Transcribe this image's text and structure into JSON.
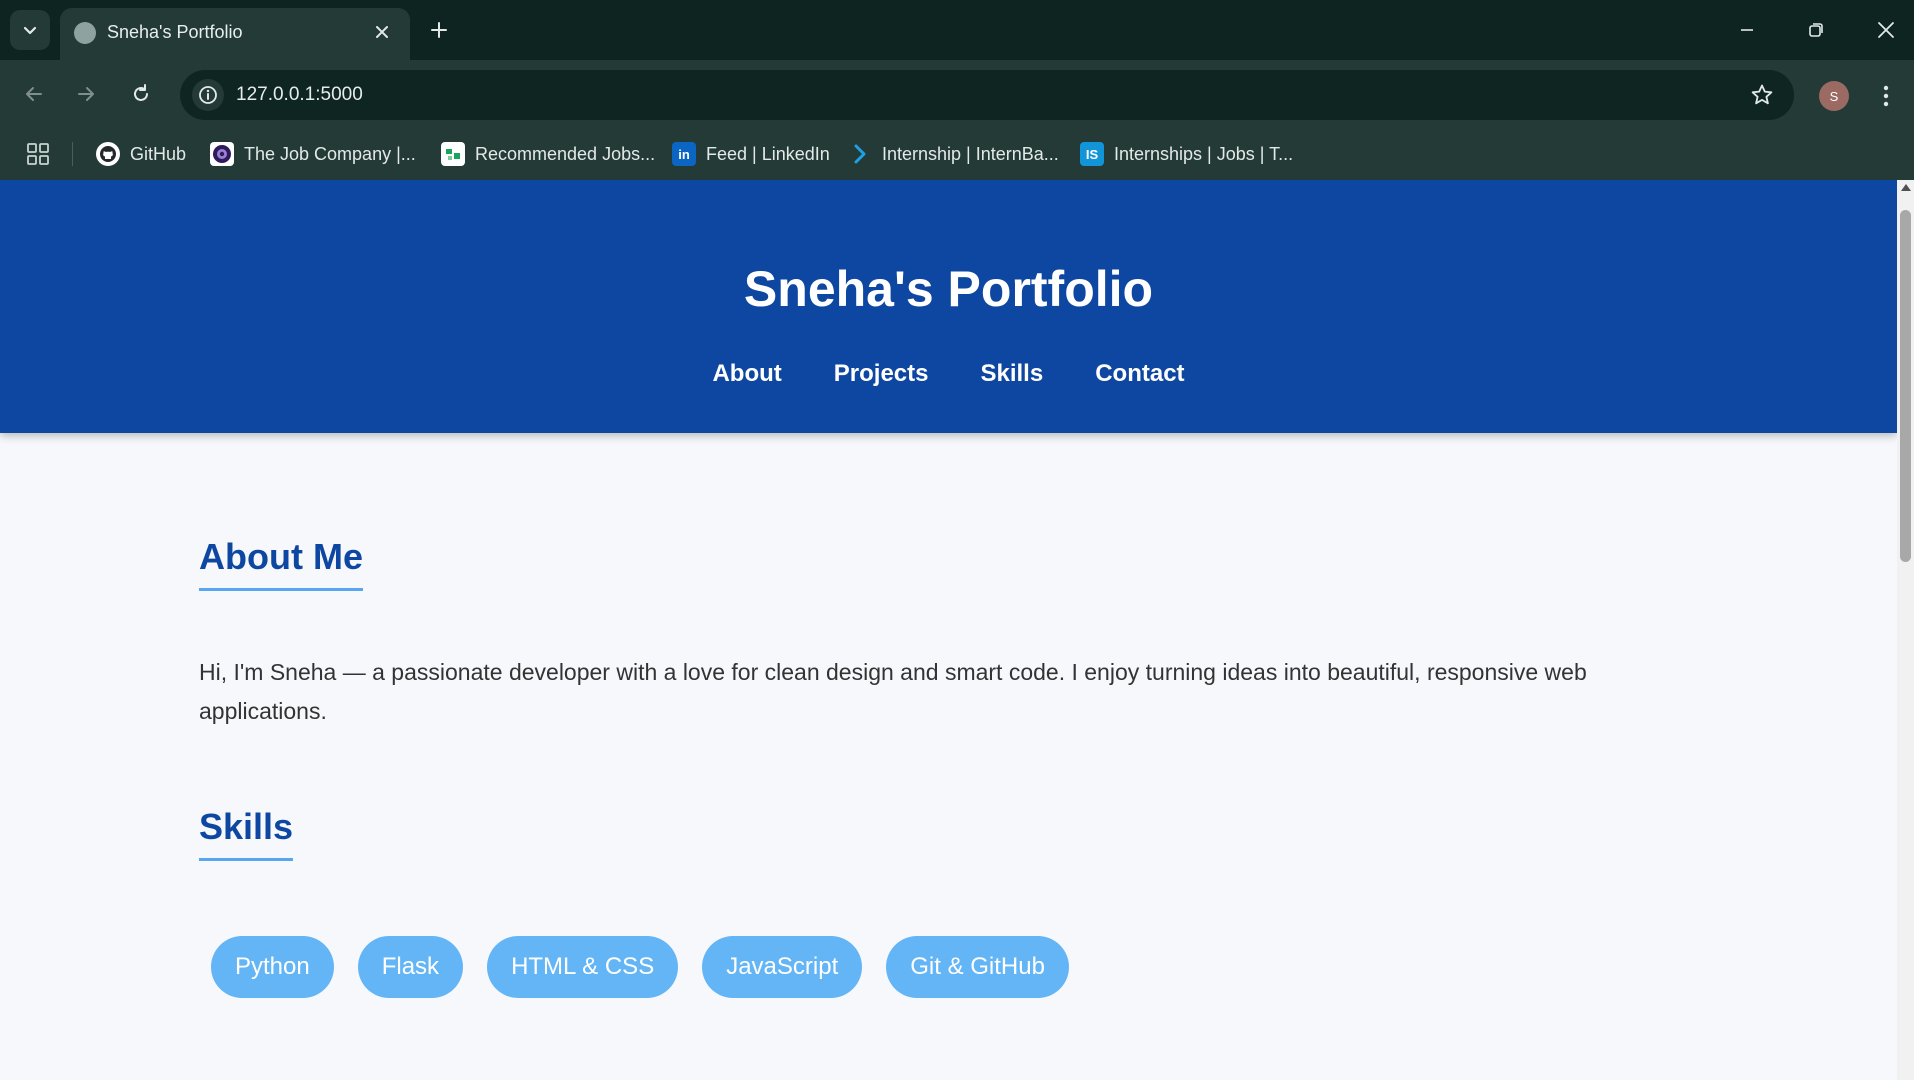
{
  "browser": {
    "tab_title": "Sneha's Portfolio",
    "url": "127.0.0.1:5000",
    "profile_initial": "S",
    "bookmarks": [
      {
        "label": "GitHub",
        "icon": "github-icon"
      },
      {
        "label": "The Job Company |...",
        "icon": "job-company-icon"
      },
      {
        "label": "Recommended Jobs...",
        "icon": "recommended-jobs-icon"
      },
      {
        "label": "Feed | LinkedIn",
        "icon": "linkedin-icon",
        "icon_text": "in"
      },
      {
        "label": "Internship | InternBa...",
        "icon": "internbazaar-icon"
      },
      {
        "label": "Internships | Jobs | T...",
        "icon": "internshala-icon",
        "icon_text": "IS"
      }
    ]
  },
  "site": {
    "title": "Sneha's Portfolio",
    "nav": [
      "About",
      "Projects",
      "Skills",
      "Contact"
    ]
  },
  "about": {
    "heading": "About Me",
    "text": "Hi, I'm Sneha — a passionate developer with a love for clean design and smart code. I enjoy turning ideas into beautiful, responsive web applications."
  },
  "skills": {
    "heading": "Skills",
    "items": [
      "Python",
      "Flask",
      "HTML & CSS",
      "JavaScript",
      "Git & GitHub"
    ]
  },
  "colors": {
    "header_bg": "#0d47a1",
    "heading": "#0d47a1",
    "underline": "#5aa5ef",
    "skill_tag": "#64b5f6",
    "page_bg": "#f6f8fc",
    "browser_frame": "#0e2421",
    "browser_toolbar": "#233a37"
  }
}
